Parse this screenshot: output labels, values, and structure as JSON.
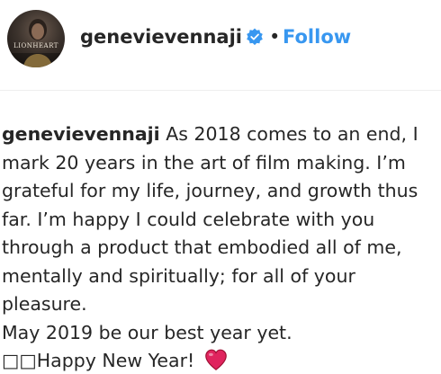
{
  "post_header": {
    "avatar_text": "LIONHEART",
    "username": "genevievennaji",
    "separator": "•",
    "follow_label": "Follow",
    "verified_icon": "verified-badge-icon",
    "accent_color": "#3897f0"
  },
  "caption": {
    "username": "genevievennaji",
    "body": "As 2018 comes to an end, I mark 20 years in the art of film making. I’m grateful for my life, journey, and growth thus far. I’m happy I could celebrate with you through a product that embodied all of me, mentally and spiritually; for all of your pleasure.",
    "line2": "May 2019 be our best year yet.",
    "line3_prefix": "□□",
    "line3_text": "Happy New Year! ",
    "heart_icon": "red-heart-icon",
    "heart_color": "#e0245e"
  }
}
